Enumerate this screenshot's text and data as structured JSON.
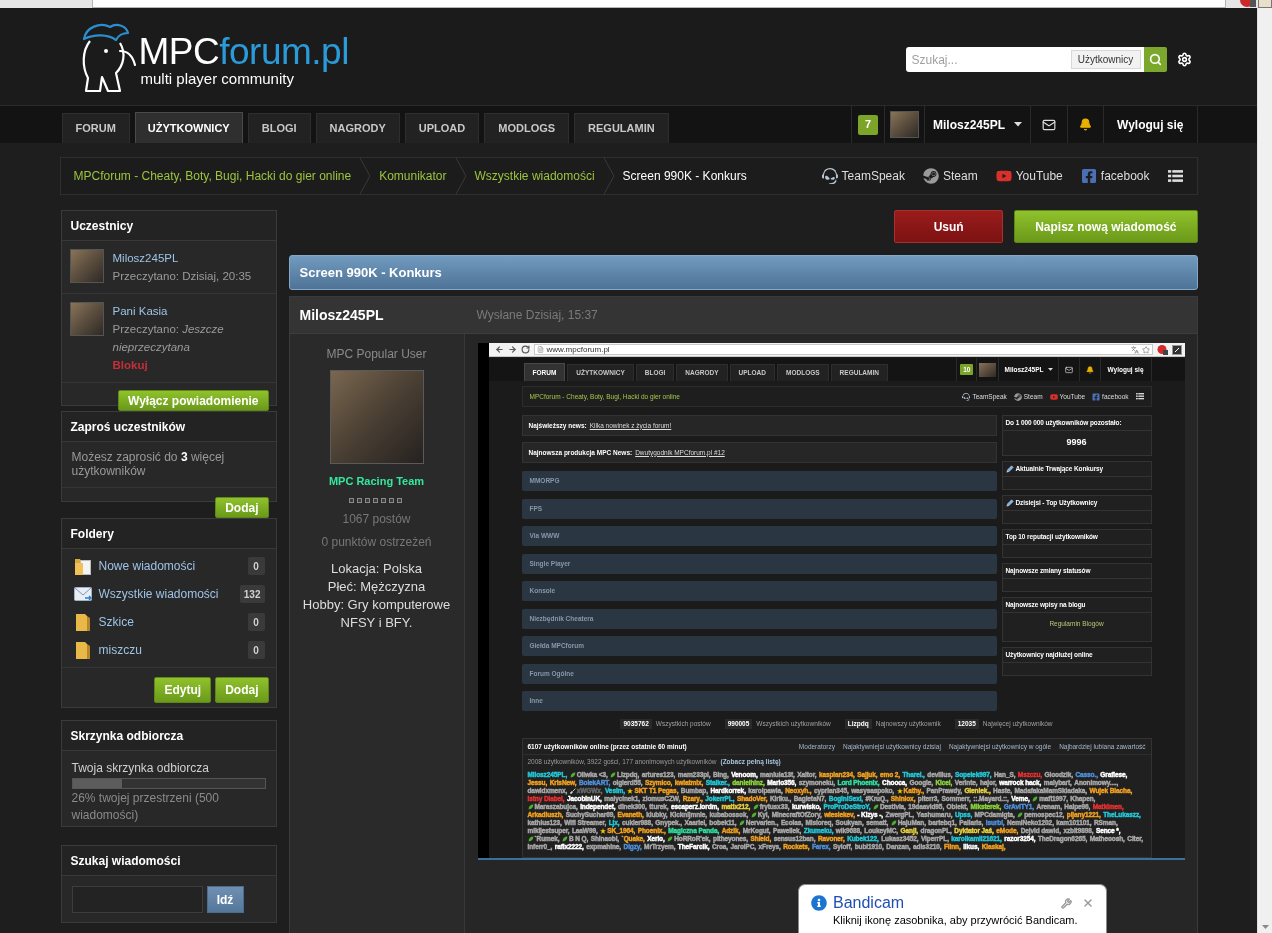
{
  "header": {
    "logo": {
      "brand": "MPC",
      "suffix": "forum.pl",
      "tagline": "multi player community"
    },
    "search": {
      "placeholder": "Szukaj...",
      "scope": "Użytkownicy"
    }
  },
  "nav": {
    "tabs": [
      {
        "label": "FORUM",
        "selected": false
      },
      {
        "label": "UŻYTKOWNICY",
        "selected": true
      },
      {
        "label": "BLOGI",
        "selected": false
      },
      {
        "label": "NAGRODY",
        "selected": false
      },
      {
        "label": "UPLOAD",
        "selected": false
      },
      {
        "label": "MODLOGS",
        "selected": false
      },
      {
        "label": "REGULAMIN",
        "selected": false
      }
    ],
    "notifications": "7",
    "user": "Milosz245PL",
    "logout": "Wyloguj się"
  },
  "breadcrumb": {
    "items": [
      {
        "label": "MPCforum - Cheaty, Boty, Bugi, Hacki do gier online",
        "current": false
      },
      {
        "label": "Komunikator",
        "current": false
      },
      {
        "label": "Wszystkie wiadomości",
        "current": false
      },
      {
        "label": "Screen 990K - Konkurs",
        "current": true
      }
    ],
    "links": [
      {
        "label": "TeamSpeak",
        "kind": "teamspeak"
      },
      {
        "label": "Steam",
        "kind": "steam"
      },
      {
        "label": "YouTube",
        "kind": "youtube"
      },
      {
        "label": "facebook",
        "kind": "facebook"
      }
    ]
  },
  "sidebar": {
    "participants": {
      "title": "Uczestnicy",
      "members": [
        {
          "name": "Milosz245PL",
          "read": "Przeczytano: Dzisiaj, 20:35"
        },
        {
          "name": "Pani Kasia",
          "read": "Przeczytano: *Jeszcze nieprzeczytana*",
          "action": "Blokuj"
        }
      ],
      "button": "Wyłącz powiadomienie"
    },
    "invite": {
      "title": "Zaproś uczestników",
      "text": "Możesz zaprosić do **3** więcej użytkowników",
      "button": "Dodaj"
    },
    "folders": {
      "title": "Foldery",
      "items": [
        {
          "label": "Nowe wiadomości",
          "count": "0",
          "kind": "new"
        },
        {
          "label": "Wszystkie wiadomości",
          "count": "132",
          "kind": "all"
        },
        {
          "label": "Szkice",
          "count": "0",
          "kind": "folder"
        },
        {
          "label": "miszczu",
          "count": "0",
          "kind": "folder"
        }
      ],
      "buttons": [
        "Edytuj",
        "Dodaj"
      ]
    },
    "inbox": {
      "title": "Skrzynka odbiorcza",
      "label": "Twoja skrzynka odbiorcza",
      "level": 0.26,
      "usage": "26% twojej przestrzeni (500 wiadomości)"
    },
    "search": {
      "title": "Szukaj wiadomości",
      "button": "Idź"
    }
  },
  "actions": [
    {
      "label": "Usuń",
      "kind": "danger"
    },
    {
      "label": "Napisz nową wiadomość",
      "kind": "primary"
    }
  ],
  "conversation": {
    "title": "Screen 990K - Konkurs",
    "post": {
      "author": "Milosz245PL",
      "sent": "Wysłane Dzisiaj, 15:37",
      "rank": "MPC Popular User",
      "group": "MPC Racing Team",
      "posts": "1067 postów",
      "warnings": "0 punktów ostrzeżeń",
      "profile": [
        "Lokacja: Polska",
        "Płeć: Mężczyzna",
        "Hobby: Gry komputerowe NFSY i BFY."
      ]
    }
  },
  "screenshot": {
    "address": "www.mpcforum.pl",
    "tabs": [
      {
        "label": "FORUM",
        "selected": true
      },
      {
        "label": "UŻYTKOWNICY",
        "selected": false
      },
      {
        "label": "BLOGI",
        "selected": false
      },
      {
        "label": "NAGRODY",
        "selected": false
      },
      {
        "label": "UPLOAD",
        "selected": false
      },
      {
        "label": "MODLOGS",
        "selected": false
      },
      {
        "label": "REGULAMIN",
        "selected": false
      }
    ],
    "notifications": "10",
    "user": "Milosz245PL",
    "logout": "Wyloguj się",
    "breadcrumb": "MPCforum - Cheaty, Boty, Bugi, Hacki do gier online",
    "links": [
      {
        "label": "TeamSpeak",
        "kind": "teamspeak"
      },
      {
        "label": "Steam",
        "kind": "steam"
      },
      {
        "label": "YouTube",
        "kind": "youtube"
      },
      {
        "label": "facebook",
        "kind": "facebook"
      }
    ],
    "news": [
      {
        "label": "Najświeższy news:",
        "link": "Kilka nowinek z życia forum!"
      },
      {
        "label": "Najnowsza produkcja MPC News:",
        "link": "Dwutygodnik MPCforum.pl #12"
      }
    ],
    "categories": [
      "MMORPG",
      "FPS",
      "Via WWW",
      "Single Player",
      "Konsole",
      "Niezbędnik Cheatera",
      "Giełda MPCforum",
      "Forum Ogólne",
      "Inne"
    ],
    "stats": [
      {
        "value": "9035762",
        "label": "Wszystkich postów"
      },
      {
        "value": "990005",
        "label": "Wszystkich użytkowników"
      },
      {
        "value": "Lizpdq",
        "label": "Najnowszy użytkownik"
      },
      {
        "value": "12035",
        "label": "Najwięcej użytkowników"
      }
    ],
    "widgets": [
      {
        "title": "Do 1 000 000 użytkowników pozostało:",
        "icon": false,
        "value": "9996"
      },
      {
        "title": "Aktualnie Trwające Konkursy",
        "icon": true
      },
      {
        "title": "Dzisiejsi - Top Użytkownicy",
        "icon": true
      },
      {
        "title": "Top 10 reputacji użytkowników",
        "icon": false
      },
      {
        "title": "Najnowsze zmiany statusów",
        "icon": false
      },
      {
        "title": "Najnowsze wpisy na blogu",
        "icon": false,
        "link": "Regulamin Blogów"
      },
      {
        "title": "Użytkownicy najdłużej online",
        "icon": false
      }
    ],
    "online": {
      "title": "6107 użytkowników online (przez ostatnie 60 minut)",
      "tabs": [
        "Moderatorzy",
        "Najaktywniejsi użytkownicy dzisiaj",
        "Najaktywniejsi użytkownicy w ogóle",
        "Najbardziej lubiana zawartość"
      ],
      "summary": "2008 użytkowników, 3922 gości, 177 anonimowych użytkowników",
      "full_list": "(Zobacz pełną listę)",
      "users": [
        {
          "name": "Milosz245PL,",
          "color": "#22c8d8",
          "kind": "plain"
        },
        {
          "name": "Oliwka <3,",
          "color": "#a8a8a8",
          "kind": "leaf"
        },
        {
          "name": "Lizpdq,",
          "color": "#a8a8a8",
          "kind": "leaf"
        },
        {
          "name": "artures123,",
          "color": "#a8a8a8",
          "kind": "plain"
        },
        {
          "name": "mam233pl,",
          "color": "#a8a8a8",
          "kind": "plain"
        },
        {
          "name": "Bing,",
          "color": "#a8a8a8",
          "kind": "plain"
        },
        {
          "name": "Venoom,",
          "color": "#ffffff",
          "kind": "plain"
        },
        {
          "name": "maniula13t,",
          "color": "#a8a8a8",
          "kind": "plain"
        },
        {
          "name": "Xaltor,",
          "color": "#a8a8a8",
          "kind": "plain"
        },
        {
          "name": "kaspian234,",
          "color": "#f0a020",
          "kind": "plain"
        },
        {
          "name": "Sajjuk,",
          "color": "#f0a020",
          "kind": "plain"
        },
        {
          "name": "emo 2,",
          "color": "#f0a020",
          "kind": "plain"
        },
        {
          "name": "Tharel.,",
          "color": "#22c8d8",
          "kind": "plain"
        },
        {
          "name": "devilius,",
          "color": "#a8a8a8",
          "kind": "plain"
        },
        {
          "name": "Sopelek997,",
          "color": "#22c8d8",
          "kind": "plain"
        },
        {
          "name": "Han_S,",
          "color": "#a8a8a8",
          "kind": "plain"
        },
        {
          "name": "Mszczu,",
          "color": "#e83030",
          "kind": "plain"
        },
        {
          "name": "Gloodzik,",
          "color": "#a8a8a8",
          "kind": "plain"
        },
        {
          "name": "Casso.,",
          "color": "#4f8fd8",
          "kind": "plain"
        },
        {
          "name": "Grafiese,",
          "color": "#ffffff",
          "kind": "plain"
        },
        {
          "name": "Jessu,",
          "color": "#f0a020",
          "kind": "plain"
        },
        {
          "name": "KrisNew,",
          "color": "#f0a020",
          "kind": "plain"
        },
        {
          "name": "BolekART,",
          "color": "#4f8fd8",
          "kind": "plain"
        },
        {
          "name": "olgierd55,",
          "color": "#a8a8a8",
          "kind": "plain"
        },
        {
          "name": "Szymico,",
          "color": "#f0a020",
          "kind": "plain"
        },
        {
          "name": "kwiatmix,",
          "color": "#f0a020",
          "kind": "plain"
        },
        {
          "name": "Stalker.,",
          "color": "#22c8d8",
          "kind": "plain"
        },
        {
          "name": "danielhinz,",
          "color": "#8bd23a",
          "kind": "plain"
        },
        {
          "name": "Mario356,",
          "color": "#ffffff",
          "kind": "plain"
        },
        {
          "name": "szymoneku,",
          "color": "#a8a8a8",
          "kind": "plain"
        },
        {
          "name": "Lord Phoenix,",
          "color": "#30e0a0",
          "kind": "plain"
        },
        {
          "name": "Chooca,",
          "color": "#ffffff",
          "kind": "plain"
        },
        {
          "name": "Google,",
          "color": "#a8a8a8",
          "kind": "plain"
        },
        {
          "name": "Kicel,",
          "color": "#8bd23a",
          "kind": "plain"
        },
        {
          "name": "Verinte,",
          "color": "#a8a8a8",
          "kind": "plain"
        },
        {
          "name": "hajor,",
          "color": "#a8a8a8",
          "kind": "plain"
        },
        {
          "name": "warrock hack,",
          "color": "#ffffff",
          "kind": "plain"
        },
        {
          "name": "malybart,",
          "color": "#a8a8a8",
          "kind": "plain"
        },
        {
          "name": "Anonimowy....,",
          "color": "#a8a8a8",
          "kind": "plain"
        },
        {
          "name": "dawidxmenx,",
          "color": "#a8a8a8",
          "kind": "plain"
        },
        {
          "name": "xWGWx,",
          "color": "#6a6a6a",
          "kind": "brush"
        },
        {
          "name": "Vesim,",
          "color": "#22c8d8",
          "kind": "plain"
        },
        {
          "name": "SKT T1 Pegas,",
          "color": "#f0a020",
          "kind": "star"
        },
        {
          "name": "Bumbap,",
          "color": "#a8a8a8",
          "kind": "plain"
        },
        {
          "name": "Hardkorrek,",
          "color": "#ffffff",
          "kind": "plain"
        },
        {
          "name": "karolpawia,",
          "color": "#a8a8a8",
          "kind": "plain"
        },
        {
          "name": "Neoxyh.,",
          "color": "#f0a020",
          "kind": "plain"
        },
        {
          "name": "cyprian345,",
          "color": "#a8a8a8",
          "kind": "plain"
        },
        {
          "name": "wasysaspoko,",
          "color": "#a8a8a8",
          "kind": "plain"
        },
        {
          "name": "Kathy.,",
          "color": "#f0a020",
          "kind": "star"
        },
        {
          "name": "PanPrawdy,",
          "color": "#a8a8a8",
          "kind": "plain"
        },
        {
          "name": "Gieniek.,",
          "color": "#e8d040",
          "kind": "plain"
        },
        {
          "name": "Haste,",
          "color": "#a8a8a8",
          "kind": "plain"
        },
        {
          "name": "MadafakaMamSkladaka,",
          "color": "#a8a8a8",
          "kind": "plain"
        },
        {
          "name": "Wujek Blacha,",
          "color": "#f0a020",
          "kind": "plain"
        },
        {
          "name": "Istny Diabel,",
          "color": "#e83030",
          "kind": "plain"
        },
        {
          "name": "JacobInUK,",
          "color": "#ffffff",
          "kind": "plain"
        },
        {
          "name": "malycinek1,",
          "color": "#a8a8a8",
          "kind": "plain"
        },
        {
          "name": "ziomusCZW,",
          "color": "#a8a8a8",
          "kind": "plain"
        },
        {
          "name": "Rzary.,",
          "color": "#f0a020",
          "kind": "plain"
        },
        {
          "name": "JokerrPL,",
          "color": "#22c8d8",
          "kind": "plain"
        },
        {
          "name": "ShadoVer,",
          "color": "#f0a020",
          "kind": "plain"
        },
        {
          "name": "Kiriku.,",
          "color": "#a8a8a8",
          "kind": "plain"
        },
        {
          "name": "BagietaN7,",
          "color": "#a8a8a8",
          "kind": "plain"
        },
        {
          "name": "BoginiSexi,",
          "color": "#22c8d8",
          "kind": "plain"
        },
        {
          "name": "#KruQ.,",
          "color": "#a8a8a8",
          "kind": "plain"
        },
        {
          "name": "Shiniox,",
          "color": "#f0a020",
          "kind": "plain"
        },
        {
          "name": "piterr3,",
          "color": "#a8a8a8",
          "kind": "plain"
        },
        {
          "name": "Sommerr,",
          "color": "#a8a8a8",
          "kind": "plain"
        },
        {
          "name": "::.Mayard.::,",
          "color": "#a8a8a8",
          "kind": "plain"
        },
        {
          "name": "Veme,",
          "color": "#ffffff",
          "kind": "plain"
        },
        {
          "name": "mafi1997,",
          "color": "#a8a8a8",
          "kind": "leaf"
        },
        {
          "name": "Khapen,",
          "color": "#a8a8a8",
          "kind": "plain"
        },
        {
          "name": "Maraszabujca,",
          "color": "#a8a8a8",
          "kind": "leaf"
        },
        {
          "name": "Independet,",
          "color": "#ffffff",
          "kind": "plain"
        },
        {
          "name": "dinek300,",
          "color": "#a8a8a8",
          "kind": "plain"
        },
        {
          "name": "tturek,",
          "color": "#a8a8a8",
          "kind": "plain"
        },
        {
          "name": "escaperz.lordm,",
          "color": "#ffffff",
          "kind": "plain"
        },
        {
          "name": "matix212,",
          "color": "#e8d040",
          "kind": "plain"
        },
        {
          "name": "frytusx33,",
          "color": "#a8a8a8",
          "kind": "leaf"
        },
        {
          "name": "kurwisko,",
          "color": "#ffffff",
          "kind": "plain"
        },
        {
          "name": "ProProDeStroY,",
          "color": "#22c8d8",
          "kind": "plain"
        },
        {
          "name": "Destivia,",
          "color": "#a8a8a8",
          "kind": "leaf"
        },
        {
          "name": "19daavid95,",
          "color": "#a8a8a8",
          "kind": "plain"
        },
        {
          "name": "Obiekt,",
          "color": "#a8a8a8",
          "kind": "plain"
        },
        {
          "name": "Miksterek,",
          "color": "#8bd23a",
          "kind": "plain"
        },
        {
          "name": "GrAvITY1,",
          "color": "#4f8fd8",
          "kind": "plain"
        },
        {
          "name": "Arenam,",
          "color": "#a8a8a8",
          "kind": "plain"
        },
        {
          "name": "Haipe96,",
          "color": "#a8a8a8",
          "kind": "plain"
        },
        {
          "name": "Matkimen,",
          "color": "#e83030",
          "kind": "plain"
        },
        {
          "name": "Arkadiuszh,",
          "color": "#f0a020",
          "kind": "plain"
        },
        {
          "name": "SuchySuchar69,",
          "color": "#a8a8a8",
          "kind": "plain"
        },
        {
          "name": "Evaneth,",
          "color": "#f0a020",
          "kind": "plain"
        },
        {
          "name": "klubky,",
          "color": "#a8a8a8",
          "kind": "plain"
        },
        {
          "name": "Kicknijmnie,",
          "color": "#a8a8a8",
          "kind": "plain"
        },
        {
          "name": "kubabossok,",
          "color": "#a8a8a8",
          "kind": "plain"
        },
        {
          "name": "Kyi,",
          "color": "#a8a8a8",
          "kind": "leaf"
        },
        {
          "name": "MinecraftOfZory,",
          "color": "#a8a8a8",
          "kind": "plain"
        },
        {
          "name": "wiesiekev,",
          "color": "#f0a020",
          "kind": "plain"
        },
        {
          "name": "- Kizys -,",
          "color": "#ffffff",
          "kind": "plain"
        },
        {
          "name": "ZwergPL,",
          "color": "#a8a8a8",
          "kind": "plain"
        },
        {
          "name": "Yashumaru,",
          "color": "#a8a8a8",
          "kind": "plain"
        },
        {
          "name": "Upss,",
          "color": "#22c8d8",
          "kind": "plain"
        },
        {
          "name": "MPCdamigta,",
          "color": "#a8a8a8",
          "kind": "plain"
        },
        {
          "name": "pemospec12,",
          "color": "#a8a8a8",
          "kind": "leaf"
        },
        {
          "name": "pijany1221,",
          "color": "#f0a020",
          "kind": "plain"
        },
        {
          "name": "TheLukaszz,",
          "color": "#22c8d8",
          "kind": "plain"
        },
        {
          "name": "kathius123,",
          "color": "#a8a8a8",
          "kind": "plain"
        },
        {
          "name": "Wifi Streamer,",
          "color": "#a8a8a8",
          "kind": "plain"
        },
        {
          "name": "Ljx,",
          "color": "#22c8d8",
          "kind": "plain"
        },
        {
          "name": "cukier988,",
          "color": "#a8a8a8",
          "kind": "plain"
        },
        {
          "name": "Gnypek.,",
          "color": "#a8a8a8",
          "kind": "plain"
        },
        {
          "name": "Xaariel,",
          "color": "#a8a8a8",
          "kind": "plain"
        },
        {
          "name": "bobek11,",
          "color": "#a8a8a8",
          "kind": "plain"
        },
        {
          "name": "Nervarien.,",
          "color": "#a8a8a8",
          "kind": "leaf"
        },
        {
          "name": "Ecolas,",
          "color": "#a8a8a8",
          "kind": "plain"
        },
        {
          "name": "Misioreq,",
          "color": "#a8a8a8",
          "kind": "plain"
        },
        {
          "name": "Soukyan,",
          "color": "#a8a8a8",
          "kind": "plain"
        },
        {
          "name": "sematt,",
          "color": "#a8a8a8",
          "kind": "plain"
        },
        {
          "name": "HajuMan,",
          "color": "#a8a8a8",
          "kind": "leaf"
        },
        {
          "name": "bartebq1,",
          "color": "#a8a8a8",
          "kind": "plain"
        },
        {
          "name": "Pallaris,",
          "color": "#a8a8a8",
          "kind": "plain"
        },
        {
          "name": "Isurbi,",
          "color": "#4f8fd8",
          "kind": "plain"
        },
        {
          "name": "NemiNeko1202,",
          "color": "#a8a8a8",
          "kind": "plain"
        },
        {
          "name": "kam101101,",
          "color": "#a8a8a8",
          "kind": "plain"
        },
        {
          "name": "RSman,",
          "color": "#a8a8a8",
          "kind": "plain"
        },
        {
          "name": "mikijestsuper,",
          "color": "#a8a8a8",
          "kind": "plain"
        },
        {
          "name": "LaaW99,",
          "color": "#a8a8a8",
          "kind": "plain"
        },
        {
          "name": "SK_1964,",
          "color": "#f0a020",
          "kind": "star"
        },
        {
          "name": "Phoenix.,",
          "color": "#f0a020",
          "kind": "plain"
        },
        {
          "name": "Magiczna Panda,",
          "color": "#30e0a0",
          "kind": "plain"
        },
        {
          "name": "Adzik,",
          "color": "#f0a020",
          "kind": "plain"
        },
        {
          "name": "MrKogut,",
          "color": "#a8a8a8",
          "kind": "plain"
        },
        {
          "name": "Pawellek,",
          "color": "#a8a8a8",
          "kind": "plain"
        },
        {
          "name": "Zkumeku,",
          "color": "#22c8d8",
          "kind": "plain"
        },
        {
          "name": "wik9688,",
          "color": "#a8a8a8",
          "kind": "plain"
        },
        {
          "name": "LoukeyMC,",
          "color": "#a8a8a8",
          "kind": "plain"
        },
        {
          "name": "Ganji,",
          "color": "#e8d040",
          "kind": "plain"
        },
        {
          "name": "dragonPL,",
          "color": "#a8a8a8",
          "kind": "plain"
        },
        {
          "name": "Dyktator Jaś,",
          "color": "#e8d040",
          "kind": "plain"
        },
        {
          "name": "eMode,",
          "color": "#f0a020",
          "kind": "plain"
        },
        {
          "name": "Dejvid dawid,",
          "color": "#a8a8a8",
          "kind": "plain"
        },
        {
          "name": "xzbit9898,",
          "color": "#a8a8a8",
          "kind": "plain"
        },
        {
          "name": "Sence *,",
          "color": "#ffffff",
          "kind": "plain"
        },
        {
          "name": "`Rumek,",
          "color": "#a8a8a8",
          "kind": "leaf"
        },
        {
          "name": "B N Q,",
          "color": "#a8a8a8",
          "kind": "leaf"
        },
        {
          "name": "Shinaobi,",
          "color": "#a8a8a8",
          "kind": "plain"
        },
        {
          "name": "`Quake,",
          "color": "#f0a020",
          "kind": "plain"
        },
        {
          "name": "Xerio,",
          "color": "#ffffff",
          "kind": "plain"
        },
        {
          "name": "HoRRoR'ek,",
          "color": "#a8a8a8",
          "kind": "leaf"
        },
        {
          "name": "pitheyones,",
          "color": "#a8a8a8",
          "kind": "plain"
        },
        {
          "name": "Shield,",
          "color": "#f0a020",
          "kind": "plain"
        },
        {
          "name": "sensus12ban,",
          "color": "#a8a8a8",
          "kind": "plain"
        },
        {
          "name": "Ravoner,",
          "color": "#f0a020",
          "kind": "plain"
        },
        {
          "name": "Kubek122,",
          "color": "#22c8d8",
          "kind": "plain"
        },
        {
          "name": "Lukasz3452,",
          "color": "#a8a8a8",
          "kind": "plain"
        },
        {
          "name": "ViperrPL,",
          "color": "#a8a8a8",
          "kind": "plain"
        },
        {
          "name": "karolkamil21621,",
          "color": "#22c8d8",
          "kind": "plain"
        },
        {
          "name": "razor3254,",
          "color": "#ffffff",
          "kind": "plain"
        },
        {
          "name": "TheDragon6265,",
          "color": "#a8a8a8",
          "kind": "plain"
        },
        {
          "name": "Matheoosh,",
          "color": "#a8a8a8",
          "kind": "plain"
        },
        {
          "name": "Citer,",
          "color": "#a8a8a8",
          "kind": "plain"
        },
        {
          "name": "Inferr0_,",
          "color": "#a8a8a8",
          "kind": "plain"
        },
        {
          "name": "rafix2222,",
          "color": "#ffffff",
          "kind": "plain"
        },
        {
          "name": "expmahine,",
          "color": "#a8a8a8",
          "kind": "plain"
        },
        {
          "name": "Digzy,",
          "color": "#4f8fd8",
          "kind": "plain"
        },
        {
          "name": "MrTrzyem,",
          "color": "#a8a8a8",
          "kind": "plain"
        },
        {
          "name": "TheFarcik,",
          "color": "#ffffff",
          "kind": "plain"
        },
        {
          "name": "Croa,",
          "color": "#a8a8a8",
          "kind": "plain"
        },
        {
          "name": "JarolPC,",
          "color": "#a8a8a8",
          "kind": "plain"
        },
        {
          "name": "xFreys,",
          "color": "#a8a8a8",
          "kind": "plain"
        },
        {
          "name": "Rockets,",
          "color": "#f0a020",
          "kind": "plain"
        },
        {
          "name": "Farex,",
          "color": "#4f8fd8",
          "kind": "plain"
        },
        {
          "name": "Syloff,",
          "color": "#a8a8a8",
          "kind": "plain"
        },
        {
          "name": "bubi1910,",
          "color": "#a8a8a8",
          "kind": "plain"
        },
        {
          "name": "Danzan,",
          "color": "#a8a8a8",
          "kind": "plain"
        },
        {
          "name": "adis3210,",
          "color": "#a8a8a8",
          "kind": "plain"
        },
        {
          "name": "Flinn,",
          "color": "#f0a020",
          "kind": "plain"
        },
        {
          "name": "likus,",
          "color": "#ffffff",
          "kind": "plain"
        },
        {
          "name": "Klaskaj,",
          "color": "#f0a020",
          "kind": "plain"
        }
      ]
    }
  },
  "popup": {
    "title": "Bandicam",
    "message": "Kliknij ikonę zasobnika, aby przywrócić Bandicam."
  }
}
